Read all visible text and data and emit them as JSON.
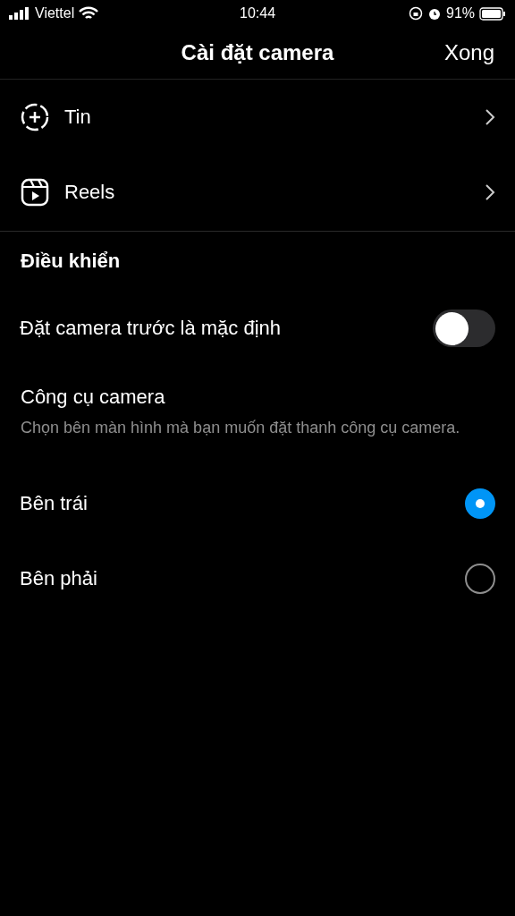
{
  "status_bar": {
    "carrier": "Viettel",
    "time": "10:44",
    "battery": "91%"
  },
  "nav": {
    "title": "Cài đặt camera",
    "done": "Xong"
  },
  "menu": [
    {
      "kind": "story",
      "label": "Tin"
    },
    {
      "kind": "reels",
      "label": "Reels"
    }
  ],
  "section": {
    "title": "Điều khiển"
  },
  "toggle": {
    "label": "Đặt camera trước là mặc định",
    "on": false
  },
  "tools": {
    "title": "Công cụ camera",
    "description": "Chọn bên màn hình mà bạn muốn đặt thanh công cụ camera."
  },
  "options": [
    {
      "label": "Bên trái",
      "selected": true
    },
    {
      "label": "Bên phải",
      "selected": false
    }
  ]
}
